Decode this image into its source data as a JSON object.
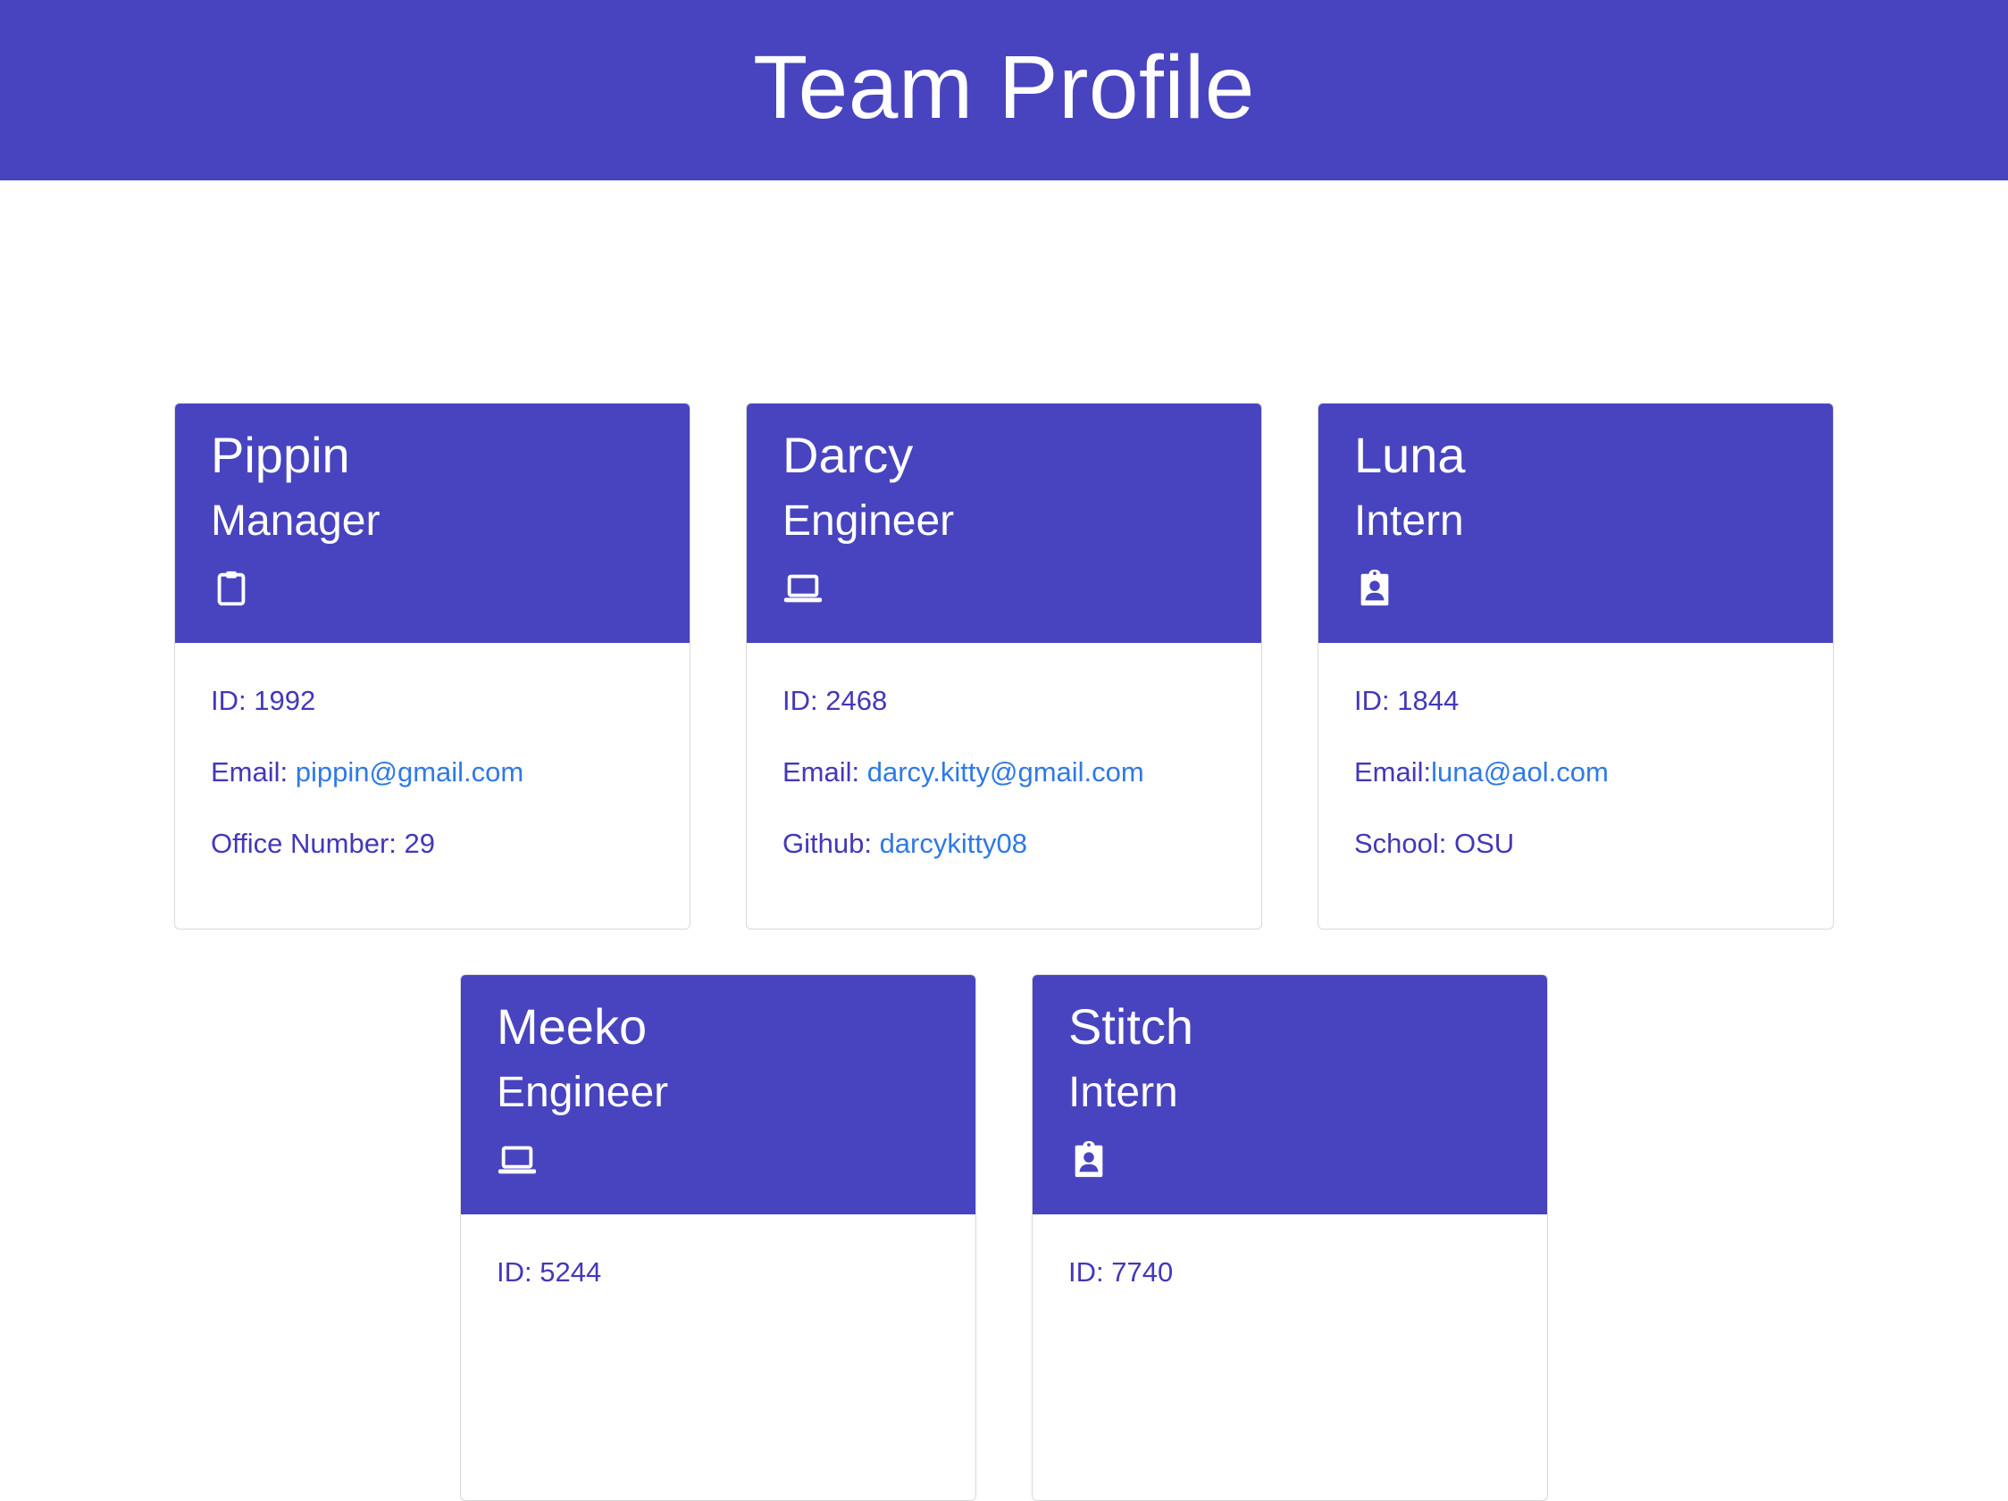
{
  "header": {
    "title": "Team Profile"
  },
  "members": [
    {
      "name": "Pippin",
      "role": "Manager",
      "icon": "clipboard-icon",
      "rows": [
        {
          "label": "ID: ",
          "value": "1992",
          "link": false
        },
        {
          "label": "Email: ",
          "value": "pippin@gmail.com",
          "link": true
        },
        {
          "label": "Office Number: ",
          "value": "29",
          "link": false
        }
      ]
    },
    {
      "name": "Darcy",
      "role": "Engineer",
      "icon": "laptop-icon",
      "rows": [
        {
          "label": "ID: ",
          "value": "2468",
          "link": false
        },
        {
          "label": "Email: ",
          "value": "darcy.kitty@gmail.com",
          "link": true
        },
        {
          "label": "Github: ",
          "value": "darcykitty08",
          "link": true
        }
      ]
    },
    {
      "name": "Luna",
      "role": "Intern",
      "icon": "id-badge-icon",
      "rows": [
        {
          "label": "ID: ",
          "value": "1844",
          "link": false
        },
        {
          "label": "Email:",
          "value": "luna@aol.com",
          "link": true
        },
        {
          "label": "School: ",
          "value": "OSU",
          "link": false
        }
      ]
    },
    {
      "name": "Meeko",
      "role": "Engineer",
      "icon": "laptop-icon",
      "rows": [
        {
          "label": "ID: ",
          "value": "5244",
          "link": false
        }
      ]
    },
    {
      "name": "Stitch",
      "role": "Intern",
      "icon": "id-badge-icon",
      "rows": [
        {
          "label": "ID: ",
          "value": "7740",
          "link": false
        }
      ]
    }
  ],
  "colors": {
    "primary": "#4844bf",
    "text": "#4338b8",
    "link": "#2f7ae5",
    "border": "#d9d9d9"
  }
}
